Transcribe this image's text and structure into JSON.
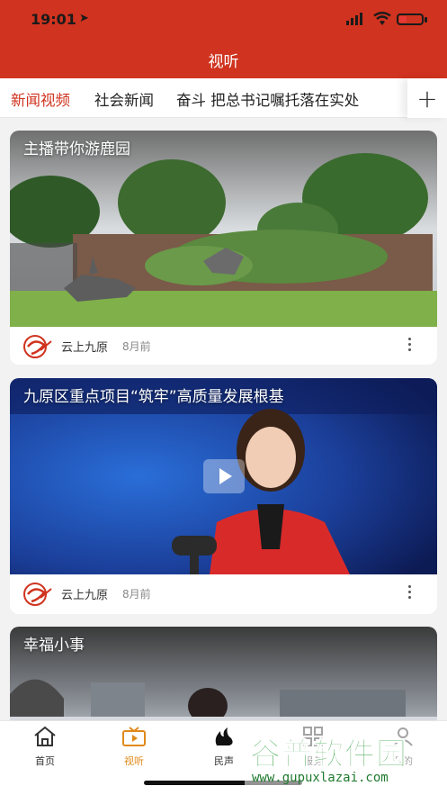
{
  "status_bar": {
    "time": "19:01"
  },
  "header": {
    "title": "视听"
  },
  "tabs": [
    {
      "label": "新闻视频",
      "active": true
    },
    {
      "label": "社会新闻",
      "active": false
    },
    {
      "label": "奋斗 把总书记嘱托落在实处",
      "active": false
    }
  ],
  "tab_add_symbol": "+",
  "videos": [
    {
      "title": "主播带你游鹿园",
      "source": "云上九原",
      "time_ago": "8月前"
    },
    {
      "title": "九原区重点项目“筑牢”高质量发展根基",
      "source": "云上九原",
      "time_ago": "8月前"
    },
    {
      "title": "幸福小事"
    }
  ],
  "bottom_nav": [
    {
      "label": "首页",
      "icon": "home-icon"
    },
    {
      "label": "视听",
      "icon": "tv-icon",
      "active": true
    },
    {
      "label": "民声",
      "icon": "flame-icon"
    },
    {
      "label": "服务",
      "icon": "grid-icon"
    },
    {
      "label": "我的",
      "icon": "user-icon"
    }
  ],
  "watermark": {
    "text": "谷普软件园",
    "url": "www.gupuxlazai.com"
  },
  "colors": {
    "brand": "#d0331f",
    "active_nav": "#e08a1a",
    "watermark": "#2e9e3c"
  }
}
